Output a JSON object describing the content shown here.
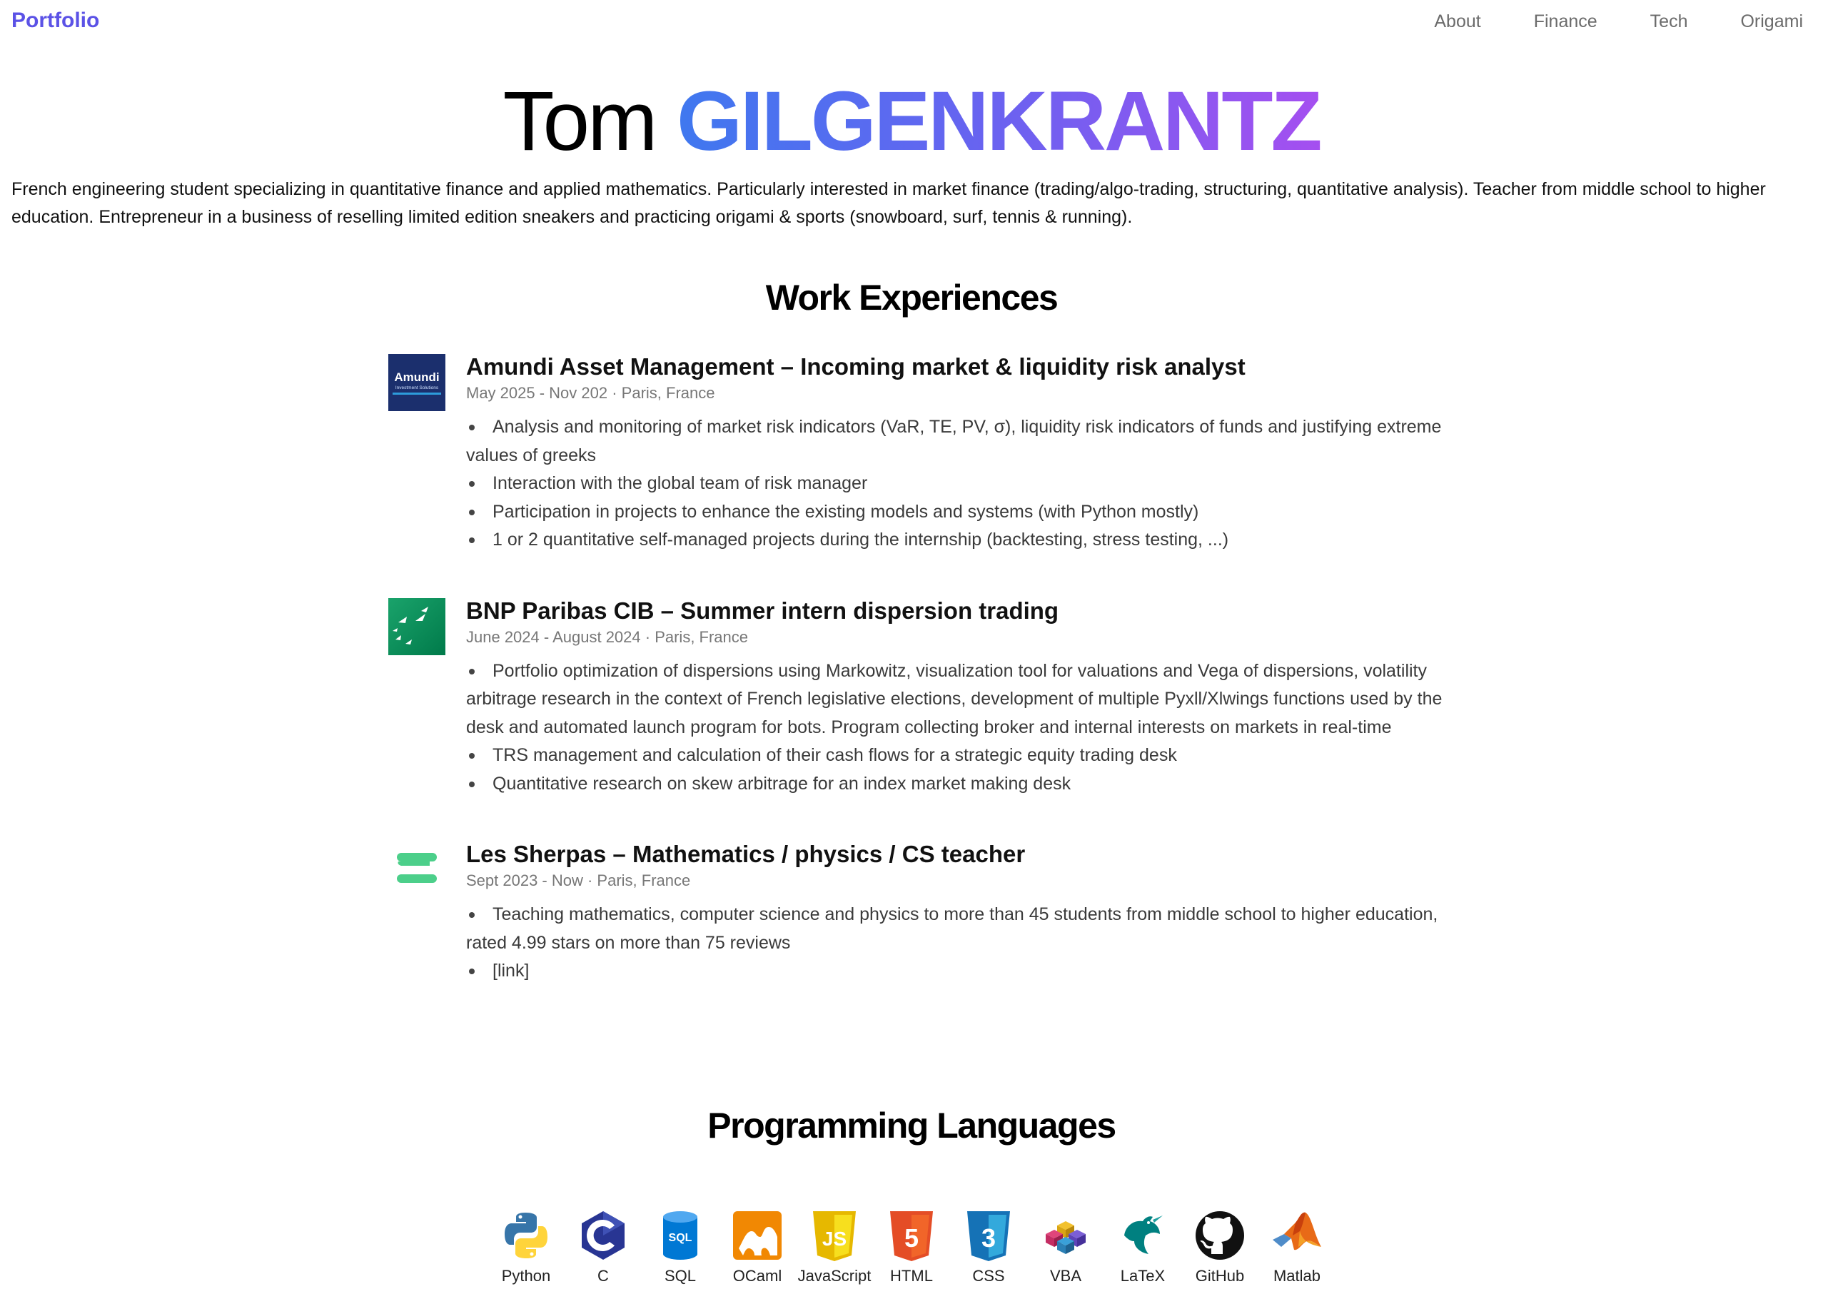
{
  "nav": {
    "brand": "Portfolio",
    "links": [
      "About",
      "Finance",
      "Tech",
      "Origami"
    ]
  },
  "hero": {
    "first_name": "Tom",
    "last_name": "GILGENKRANTZ"
  },
  "intro": "French engineering student specializing in quantitative finance and applied mathematics. Particularly interested in market finance (trading/algo-trading, structuring, quantitative analysis). Teacher from middle school to higher education. Entrepreneur in a business of reselling limited edition sneakers and practicing origami & sports (snowboard, surf, tennis & running).",
  "work": {
    "title": "Work Experiences",
    "items": [
      {
        "logo": "amundi-logo",
        "logo_text": "Amundi",
        "logo_subtext": "Investment Solutions",
        "title": "Amundi Asset Management – Incoming market & liquidity risk analyst",
        "meta": "May 2025 - Nov 202 · Paris, France",
        "bullets": [
          "Analysis and monitoring of market risk indicators (VaR, TE, PV, σ), liquidity risk indicators of funds and justifying extreme values of greeks",
          "Interaction with the global team of risk manager",
          "Participation in projects to enhance the existing models and systems (with Python mostly)",
          "1 or 2 quantitative self-managed projects during the internship (backtesting, stress testing, ...)"
        ]
      },
      {
        "logo": "bnp-paribas-logo",
        "title": "BNP Paribas CIB – Summer intern dispersion trading",
        "meta": "June 2024 - August 2024 · Paris, France",
        "bullets": [
          "Portfolio optimization of dispersions using Markowitz, visualization tool for valuations and Vega of dispersions, volatility arbitrage research in the context of French legislative elections, development of multiple Pyxll/Xlwings functions used by the desk and automated launch program for bots. Program collecting broker and internal interests on markets in real-time",
          "TRS management and calculation of their cash flows for a strategic equity trading desk",
          "Quantitative research on skew arbitrage for an index market making desk"
        ]
      },
      {
        "logo": "les-sherpas-logo",
        "title": "Les Sherpas – Mathematics / physics / CS teacher",
        "meta": "Sept 2023 - Now · Paris, France",
        "bullets": [
          "Teaching mathematics, computer science and physics to more than 45 students from middle school to higher education, rated 4.99 stars on more than 75 reviews",
          "[link]"
        ]
      }
    ]
  },
  "languages": {
    "title": "Programming Languages",
    "items": [
      {
        "name": "Python",
        "icon": "python-icon"
      },
      {
        "name": "C",
        "icon": "c-icon"
      },
      {
        "name": "SQL",
        "icon": "sql-icon"
      },
      {
        "name": "OCaml",
        "icon": "ocaml-icon"
      },
      {
        "name": "JavaScript",
        "icon": "javascript-icon"
      },
      {
        "name": "HTML",
        "icon": "html-icon"
      },
      {
        "name": "CSS",
        "icon": "css-icon"
      },
      {
        "name": "VBA",
        "icon": "vba-icon"
      },
      {
        "name": "LaTeX",
        "icon": "latex-icon"
      },
      {
        "name": "GitHub",
        "icon": "github-icon"
      },
      {
        "name": "Matlab",
        "icon": "matlab-icon"
      }
    ]
  },
  "colors": {
    "brand": "#5b52e6",
    "gradient_start": "#3f78ef",
    "gradient_end": "#a54ff0",
    "amundi_blue": "#1b2f6d",
    "bnp_green": "#00915a",
    "sherpas_green": "#4ccf8a"
  }
}
